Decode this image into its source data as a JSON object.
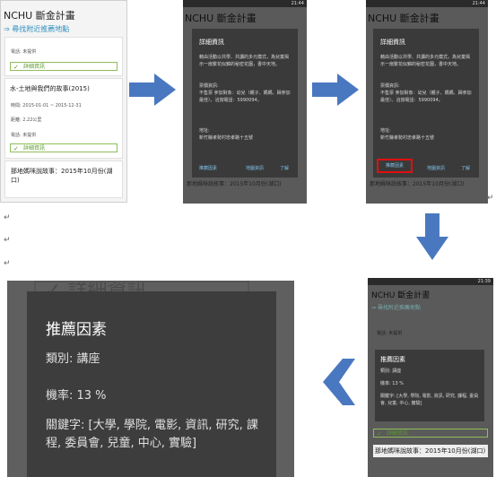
{
  "app": {
    "title": "NCHU 斷金計畫",
    "nearby_link": "⇒ 尋找附近推薦地點"
  },
  "list": {
    "card1": {
      "phone": "電話: 未提供",
      "detail_label": "詳細資訊"
    },
    "card2": {
      "title": "水-土地與我們的故事(2015)",
      "time": "時間: 2015-01-01 ~ 2015-12-31",
      "distance": "距離: 2.22公里",
      "phone": "電話: 未提供",
      "detail_label": "詳細資訊"
    },
    "card3": {
      "title": "那地媽咪說故事：2015年10月份(湖口)"
    }
  },
  "status": {
    "time_a": "21:44",
    "time_b": "21:44",
    "time_c": "21:39"
  },
  "detail_dialog": {
    "title": "詳細資訊",
    "desc": "藉由活動以共學、共讀的多元模式，為兒童揭示一扇繁花似錦的秘密花園，書中天地。",
    "ticket": "票價資訊:\n不售票 參加對象：幼兒（親子、媽媽、歸參加最佳）。洽詢電話：5990094。",
    "address_label": "地址:",
    "address": "新竹縣孝勢村忠孝路十五號",
    "btn_reason": "推薦因素",
    "btn_map": "地圖資訊",
    "btn_ok": "了解"
  },
  "reason_dialog": {
    "title": "推薦因素",
    "category": "類別: 講座",
    "probability": "機率: 13 %",
    "keywords": "關鍵字: [大學, 學院, 電影, 資訊, 研究, 課程, 委員會, 兒童, 中心, 實驗]"
  },
  "bg_detail_text": "詳細資訊",
  "small_phone": {
    "phone": "電話: 未提供",
    "detail_label": "詳細資訊",
    "bottom_card": "那地媽咪說故事：2015年10月份(湖口)"
  },
  "colors": {
    "arrow": "#4a78c0",
    "highlight": "#e01010",
    "accent_green": "#5a9a2e",
    "link": "#2f8fbf"
  }
}
